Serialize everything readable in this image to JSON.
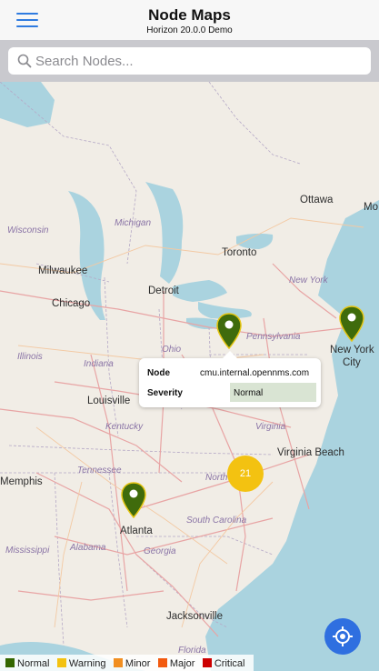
{
  "header": {
    "title": "Node Maps",
    "subtitle": "Horizon 20.0.0 Demo",
    "menu_icon": "hamburger-menu-icon"
  },
  "search": {
    "placeholder": "Search Nodes...",
    "value": ""
  },
  "map": {
    "cities": [
      {
        "name": "Ottawa"
      },
      {
        "name": "Toronto"
      },
      {
        "name": "Milwaukee"
      },
      {
        "name": "Chicago"
      },
      {
        "name": "Detroit"
      },
      {
        "name": "New York"
      },
      {
        "name": "City"
      },
      {
        "name": "Louisville"
      },
      {
        "name": "Virginia Beach"
      },
      {
        "name": "Memphis"
      },
      {
        "name": "Atlanta"
      },
      {
        "name": "Jacksonville"
      },
      {
        "name": "Mo"
      }
    ],
    "regions": [
      {
        "name": "Wisconsin"
      },
      {
        "name": "Michigan"
      },
      {
        "name": "New York"
      },
      {
        "name": "Ohio"
      },
      {
        "name": "Pennsylvania"
      },
      {
        "name": "Illinois"
      },
      {
        "name": "Indiana"
      },
      {
        "name": "Kentucky"
      },
      {
        "name": "Virginia"
      },
      {
        "name": "Tennessee"
      },
      {
        "name": "North"
      },
      {
        "name": "South Carolina"
      },
      {
        "name": "Mississippi"
      },
      {
        "name": "Alabama"
      },
      {
        "name": "Georgia"
      },
      {
        "name": "Florida"
      }
    ],
    "cluster_count": "21",
    "marker_color": "#3f6b0c",
    "cluster_color": "#f3c211"
  },
  "popup": {
    "node_label": "Node",
    "node_value": "cmu.internal.opennms.com",
    "severity_label": "Severity",
    "severity_value": "Normal"
  },
  "legend": [
    {
      "label": "Normal",
      "color": "#336600"
    },
    {
      "label": "Warning",
      "color": "#f3c211"
    },
    {
      "label": "Minor",
      "color": "#f18f21"
    },
    {
      "label": "Major",
      "color": "#f25a0f"
    },
    {
      "label": "Critical",
      "color": "#cc0000"
    }
  ],
  "locate_icon": "locate-me-icon"
}
